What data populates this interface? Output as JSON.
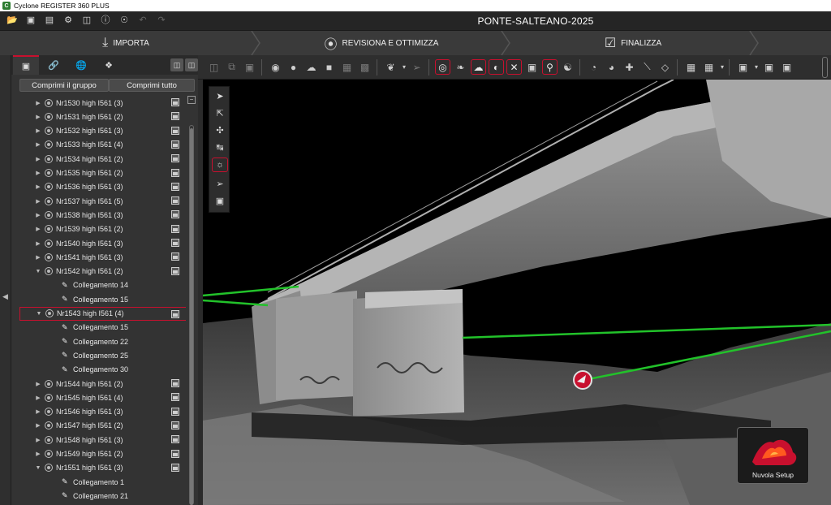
{
  "window": {
    "title": "Cyclone REGISTER 360 PLUS",
    "app_icon": "cyclone-app-icon"
  },
  "menubar": {
    "icons": [
      "open-folder-icon",
      "import-icon",
      "export-icon",
      "settings-gear-icon",
      "database-icon",
      "help-icon",
      "info-icon",
      "undo-icon",
      "redo-icon"
    ],
    "project_title": "PONTE-SALTEANO-2025"
  },
  "workflow": {
    "steps": [
      {
        "label": "IMPORTA",
        "icon": "import-download-icon",
        "active": false
      },
      {
        "label": "REVISIONA E OTTIMIZZA",
        "icon": "review-optimize-icon",
        "active": true
      },
      {
        "label": "FINALIZZA",
        "icon": "finalize-check-icon",
        "active": false
      }
    ],
    "active_color": "#c8102e"
  },
  "panel": {
    "tabs": [
      "setups-tab-icon",
      "links-tab-icon",
      "globe-tab-icon",
      "bundles-tab-icon"
    ],
    "right_tabs": [
      "panel-dock-icon",
      "panel-float-icon"
    ],
    "collapse_group_button": "Comprimi il gruppo",
    "collapse_all_button": "Comprimi tutto",
    "tree": [
      {
        "type": "setup",
        "label": "Nr1530 high I561 (3)",
        "expanded": false
      },
      {
        "type": "setup",
        "label": "Nr1531 high I561 (2)",
        "expanded": false
      },
      {
        "type": "setup",
        "label": "Nr1532 high I561 (3)",
        "expanded": false
      },
      {
        "type": "setup",
        "label": "Nr1533 high I561 (4)",
        "expanded": false
      },
      {
        "type": "setup",
        "label": "Nr1534 high I561 (2)",
        "expanded": false
      },
      {
        "type": "setup",
        "label": "Nr1535 high I561 (2)",
        "expanded": false
      },
      {
        "type": "setup",
        "label": "Nr1536 high I561 (3)",
        "expanded": false
      },
      {
        "type": "setup",
        "label": "Nr1537 high I561 (5)",
        "expanded": false
      },
      {
        "type": "setup",
        "label": "Nr1538 high I561 (3)",
        "expanded": false
      },
      {
        "type": "setup",
        "label": "Nr1539 high I561 (2)",
        "expanded": false
      },
      {
        "type": "setup",
        "label": "Nr1540 high I561 (3)",
        "expanded": false
      },
      {
        "type": "setup",
        "label": "Nr1541 high I561 (3)",
        "expanded": false
      },
      {
        "type": "setup",
        "label": "Nr1542 high I561 (2)",
        "expanded": true
      },
      {
        "type": "link",
        "label": "Collegamento 14"
      },
      {
        "type": "link",
        "label": "Collegamento 15"
      },
      {
        "type": "setup",
        "label": "Nr1543 high I561 (4)",
        "expanded": true,
        "selected": true
      },
      {
        "type": "link",
        "label": "Collegamento 15"
      },
      {
        "type": "link",
        "label": "Collegamento 22"
      },
      {
        "type": "link",
        "label": "Collegamento 25"
      },
      {
        "type": "link",
        "label": "Collegamento 30"
      },
      {
        "type": "setup",
        "label": "Nr1544 high I561 (2)",
        "expanded": false
      },
      {
        "type": "setup",
        "label": "Nr1545 high I561 (4)",
        "expanded": false
      },
      {
        "type": "setup",
        "label": "Nr1546 high I561 (3)",
        "expanded": false
      },
      {
        "type": "setup",
        "label": "Nr1547 high I561 (2)",
        "expanded": false
      },
      {
        "type": "setup",
        "label": "Nr1548 high I561 (3)",
        "expanded": false
      },
      {
        "type": "setup",
        "label": "Nr1549 high I561 (2)",
        "expanded": false
      },
      {
        "type": "setup",
        "label": "Nr1551 high I561 (3)",
        "expanded": true
      },
      {
        "type": "link",
        "label": "Collegamento 1"
      },
      {
        "type": "link",
        "label": "Collegamento 21"
      }
    ]
  },
  "toolbar": {
    "groups": [
      [
        "select-setup-icon",
        "copy-icon",
        "fit-view-icon"
      ],
      [
        "cloud-points-icon",
        "sphere-icon",
        "visual-registration-icon",
        "box-icon",
        "limit-box-icon",
        "image-icon"
      ],
      [
        "measure-icon",
        "dropdown-icon",
        "pick-icon"
      ],
      [
        "target-icon",
        "tag-icon",
        "cloud-icon",
        "checkerboard-icon",
        "link-ruler-icon",
        "camera-icon",
        "pin-icon",
        "auto-link-icon"
      ],
      [
        "pie-icon",
        "palette-icon",
        "add-point-icon",
        "line-tool-icon",
        "layers-icon"
      ],
      [
        "map-icon",
        "grid-icon",
        "dropdown-icon"
      ],
      [
        "cube-view-icon",
        "dropdown-icon",
        "vr-view-icon",
        "3d-mode-icon"
      ]
    ]
  },
  "viewport": {
    "tools": [
      "select-arrow-icon",
      "multi-select-icon",
      "orbit-icon",
      "measure-distance-icon",
      "setup-view-icon",
      "navigate-icon",
      "box-view-icon"
    ],
    "setup_thumbnail_label": "Nuvola Setup",
    "link_color": "#22c22a",
    "marker_color": "#c8102e"
  }
}
